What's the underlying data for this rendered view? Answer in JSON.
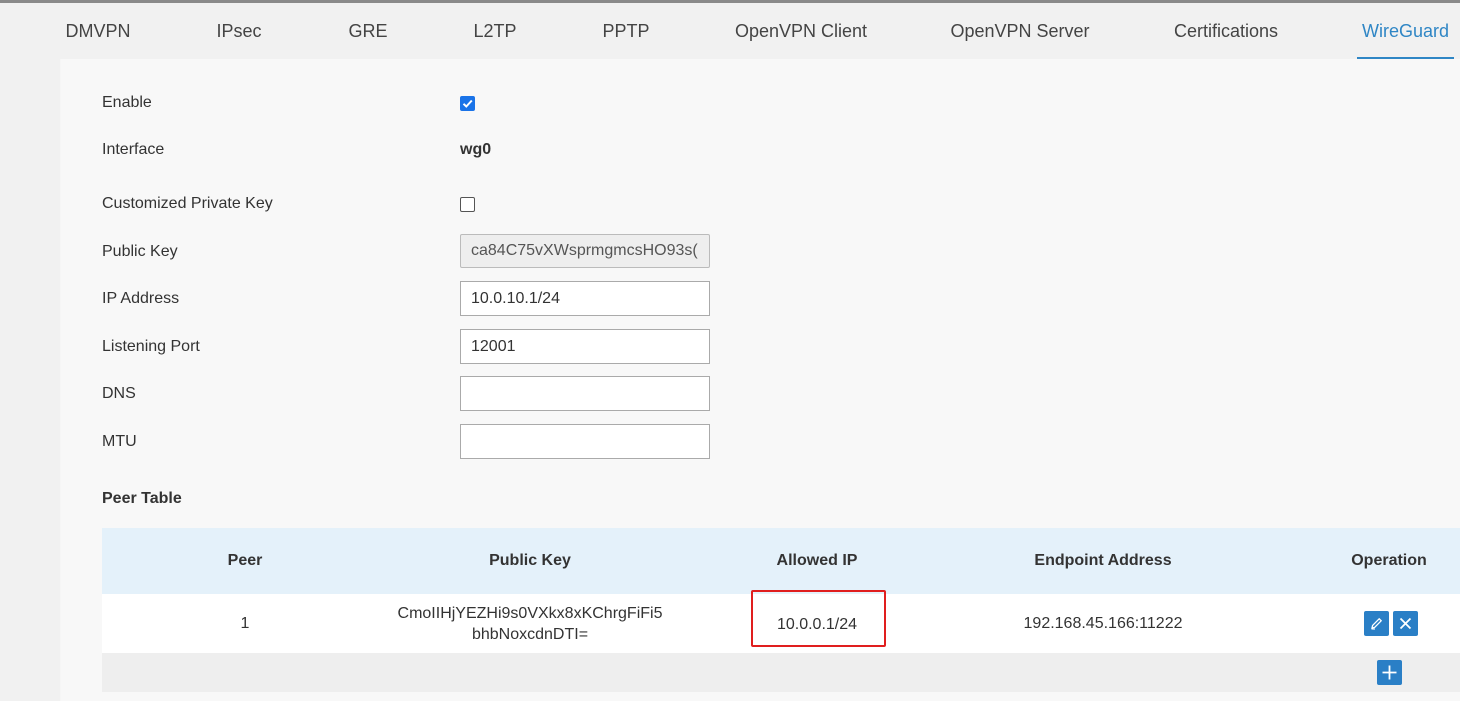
{
  "tabs": [
    {
      "label": "DMVPN",
      "active": false
    },
    {
      "label": "IPsec",
      "active": false
    },
    {
      "label": "GRE",
      "active": false
    },
    {
      "label": "L2TP",
      "active": false
    },
    {
      "label": "PPTP",
      "active": false
    },
    {
      "label": "OpenVPN Client",
      "active": false
    },
    {
      "label": "OpenVPN Server",
      "active": false
    },
    {
      "label": "Certifications",
      "active": false
    },
    {
      "label": "WireGuard",
      "active": true
    }
  ],
  "form": {
    "enable": {
      "label": "Enable",
      "checked": true
    },
    "interface": {
      "label": "Interface",
      "value": "wg0"
    },
    "custom_private_key": {
      "label": "Customized Private Key",
      "checked": false
    },
    "public_key": {
      "label": "Public Key",
      "value": "ca84C75vXWsprmgmcsHO93s("
    },
    "ip_address": {
      "label": "IP Address",
      "value": "10.0.10.1/24"
    },
    "listening_port": {
      "label": "Listening Port",
      "value": "12001"
    },
    "dns": {
      "label": "DNS",
      "value": ""
    },
    "mtu": {
      "label": "MTU",
      "value": ""
    }
  },
  "peer_table": {
    "title": "Peer Table",
    "columns": [
      "Peer",
      "Public Key",
      "Allowed IP",
      "Endpoint Address",
      "Operation"
    ],
    "rows": [
      {
        "peer": "1",
        "public_key_line1": "CmoIIHjYEZHi9s0VXkx8xKChrgFiFi5",
        "public_key_line2": "bhbNoxcdnDTI=",
        "allowed_ip": "10.0.0.1/24",
        "endpoint": "192.168.45.166:11222"
      }
    ]
  },
  "colors": {
    "accent": "#2f86c5",
    "button": "#2a7fc6",
    "highlight": "#e01e1e",
    "table_header": "#e4f1fa"
  },
  "icons": {
    "edit": "pencil-icon",
    "delete": "close-icon",
    "add": "plus-icon"
  }
}
